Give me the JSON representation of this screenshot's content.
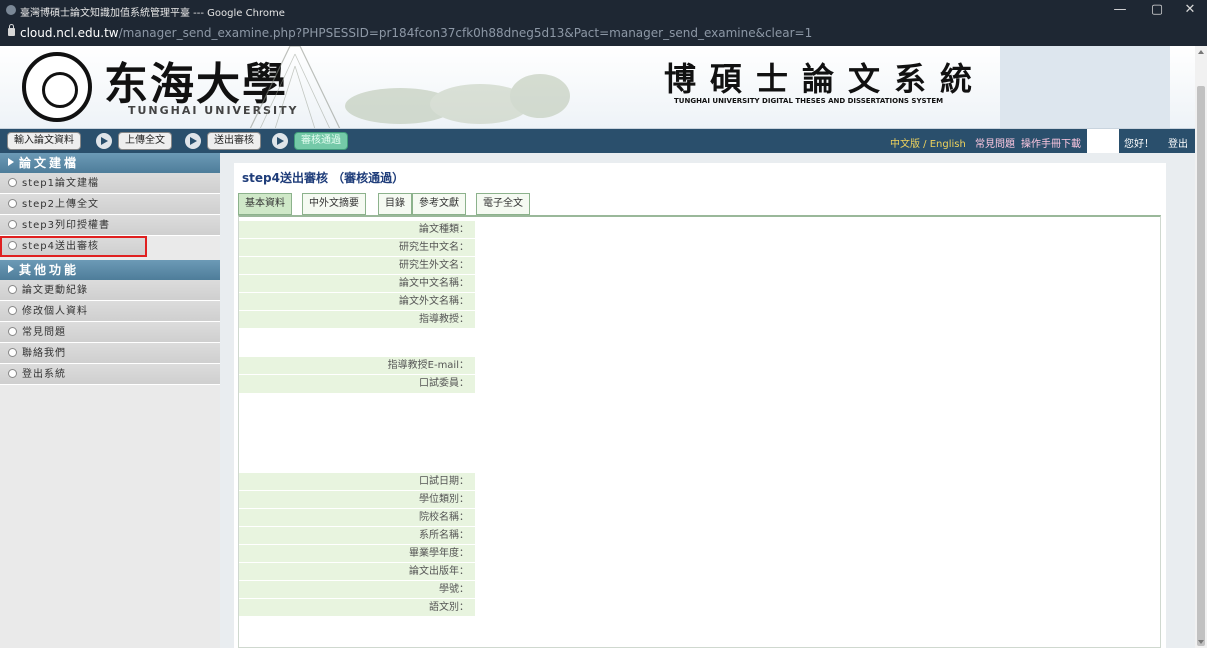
{
  "window": {
    "title": "臺灣博碩士論文知識加值系統管理平臺 --- Google Chrome",
    "controls": [
      "—",
      "▢",
      "✕"
    ]
  },
  "address": {
    "host": "cloud.ncl.edu.tw",
    "path": "/manager_send_examine.php?PHPSESSID=pr184fcon37cfk0h88dneg5d13&Pact=manager_send_examine&clear=1"
  },
  "banner": {
    "logo_cn": "东海大學",
    "logo_en": "TUNGHAI UNIVERSITY",
    "system_cn": "博碩士論文系統",
    "system_en": "TUNGHAI UNIVERSITY DIGITAL THESES AND DISSERTATIONS SYSTEM"
  },
  "steps": [
    "輸入論文資料",
    "上傳全文",
    "送出審核",
    "審核通過"
  ],
  "toplinks": {
    "lang": "中文版 / English",
    "faq": "常見問題",
    "manual": "操作手冊下載",
    "hello": "您好！",
    "logout": "登出"
  },
  "sidebar": {
    "section1": "論文建檔",
    "items1": [
      "step1論文建檔",
      "step2上傳全文",
      "step3列印授權書",
      "step4送出審核"
    ],
    "section2": "其他功能",
    "items2": [
      "論文更動紀錄",
      "修改個人資料",
      "常見問題",
      "聯絡我們",
      "登出系統"
    ]
  },
  "main": {
    "title": "step4送出審核 （審核通過）",
    "tabs": [
      "基本資料",
      "中外文摘要",
      "目錄",
      "參考文獻",
      "電子全文"
    ],
    "fields_group1": [
      "論文種類：",
      "研究生中文名：",
      "研究生外文名：",
      "論文中文名稱：",
      "論文外文名稱：",
      "指導教授："
    ],
    "fields_group2": [
      "指導教授E-mail：",
      "口試委員："
    ],
    "fields_group3": [
      "口試日期：",
      "學位類別：",
      "院校名稱：",
      "系所名稱：",
      "畢業學年度：",
      "論文出版年：",
      "學號：",
      "語文別："
    ]
  }
}
